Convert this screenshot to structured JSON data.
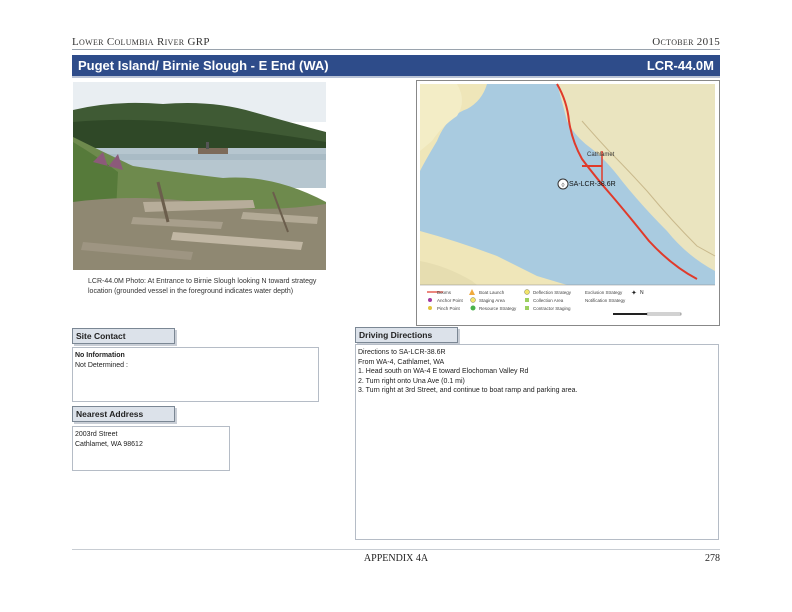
{
  "header": {
    "left": "Lower Columbia River GRP",
    "right": "October 2015"
  },
  "banner": {
    "title": "Puget Island/ Birnie Slough - E End (WA)",
    "id": "LCR-44.0M"
  },
  "photo": {
    "caption": "LCR-44.0M Photo: At Entrance to Birnie Slough looking N toward strategy location (grounded vessel in the foreground indicates water depth)"
  },
  "map": {
    "site_label": "SA-LCR-38.6R",
    "town_label": "Cathlamet",
    "legend": [
      "Booms",
      "Anchor Point",
      "Pinch Point",
      "Boat Launch",
      "Staging Area",
      "Resource Strategy",
      "Collection Area",
      "Contractor Staging",
      "Deflection Strategy",
      "Exclusion Strategy",
      "Notification Strategy"
    ],
    "north": "N"
  },
  "site_contact": {
    "label": "Site Contact",
    "name": "No Information",
    "detail": "Not Determined :"
  },
  "nearest_address": {
    "label": "Nearest Address",
    "line1": "2003rd Street",
    "line2": "Cathlamet, WA  98612"
  },
  "driving_directions": {
    "label": "Driving Directions",
    "lines": [
      "Directions to SA-LCR-38.6R",
      "From WA-4, Cathlamet, WA",
      "1. Head south on WA-4 E toward Elochoman Valley Rd",
      "2. Turn right onto Una Ave (0.1 mi)",
      "3. Turn right at 3rd Street, and continue to boat ramp and parking area."
    ]
  },
  "footer": {
    "center": "APPENDIX 4A",
    "page": "278"
  }
}
